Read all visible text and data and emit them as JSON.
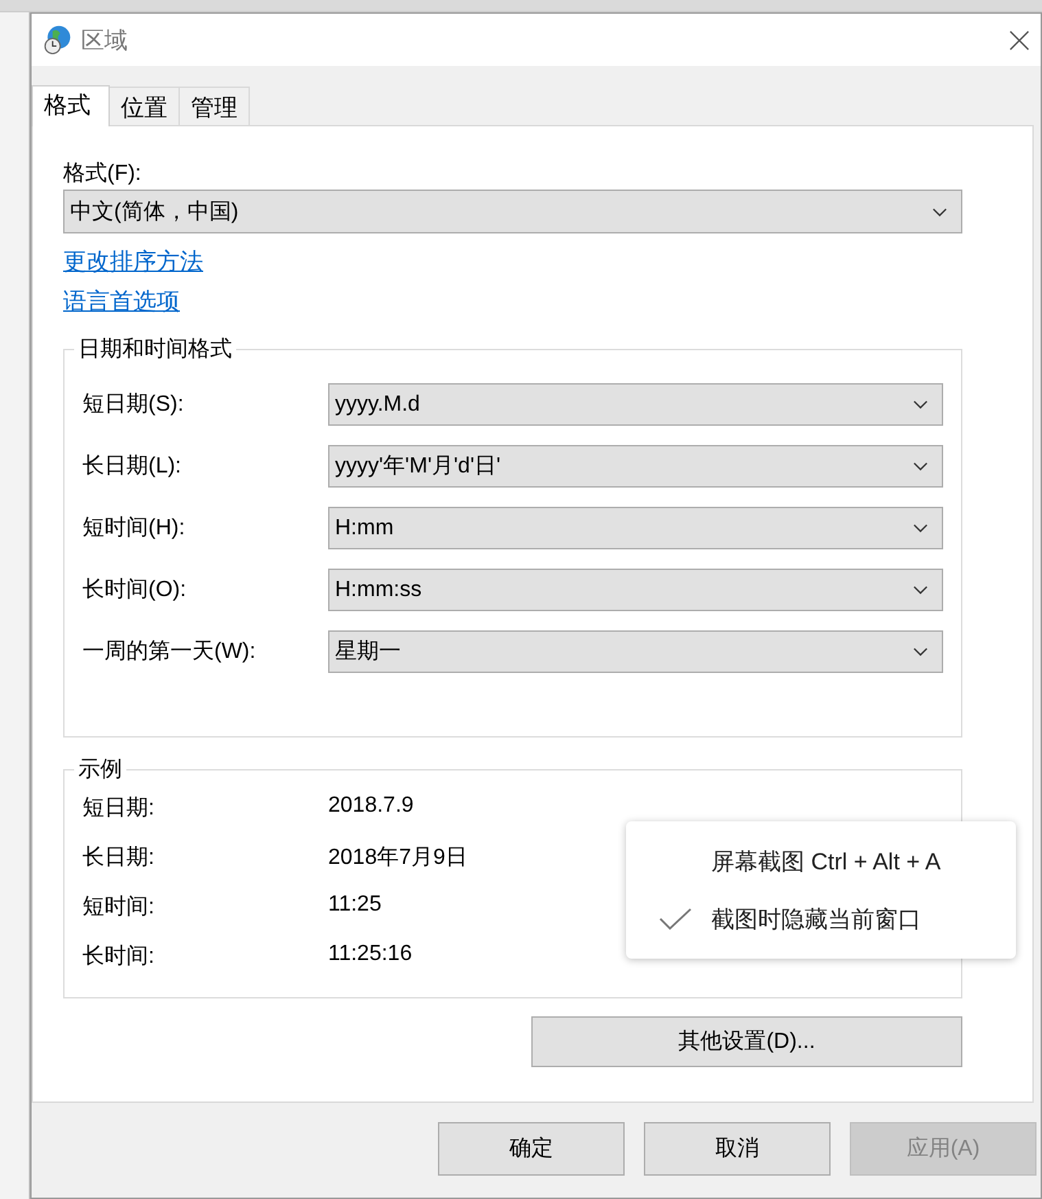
{
  "window": {
    "title": "区域"
  },
  "tabs": [
    {
      "label": "格式",
      "selected": true
    },
    {
      "label": "位置",
      "selected": false
    },
    {
      "label": "管理",
      "selected": false
    }
  ],
  "format": {
    "label": "格式(F):",
    "value": "中文(简体，中国)"
  },
  "links": [
    "更改排序方法",
    "语言首选项"
  ],
  "date_time_formats": {
    "title": "日期和时间格式",
    "rows": [
      {
        "label": "短日期(S):",
        "value": "yyyy.M.d"
      },
      {
        "label": "长日期(L):",
        "value": "yyyy'年'M'月'd'日'"
      },
      {
        "label": "短时间(H):",
        "value": "H:mm"
      },
      {
        "label": "长时间(O):",
        "value": "H:mm:ss"
      },
      {
        "label": "一周的第一天(W):",
        "value": "星期一"
      }
    ]
  },
  "examples": {
    "title": "示例",
    "rows": [
      {
        "label": "短日期:",
        "value": "2018.7.9"
      },
      {
        "label": "长日期:",
        "value": "2018年7月9日"
      },
      {
        "label": "短时间:",
        "value": "11:25"
      },
      {
        "label": "长时间:",
        "value": "11:25:16"
      }
    ]
  },
  "other_settings_button": "其他设置(D)...",
  "buttons": [
    {
      "label": "确定",
      "disabled": false
    },
    {
      "label": "取消",
      "disabled": false
    },
    {
      "label": "应用(A)",
      "disabled": true
    }
  ],
  "context_menu": {
    "items": [
      {
        "label": "屏幕截图 Ctrl + Alt + A",
        "checked": false
      },
      {
        "label": "截图时隐藏当前窗口",
        "checked": true
      }
    ]
  }
}
